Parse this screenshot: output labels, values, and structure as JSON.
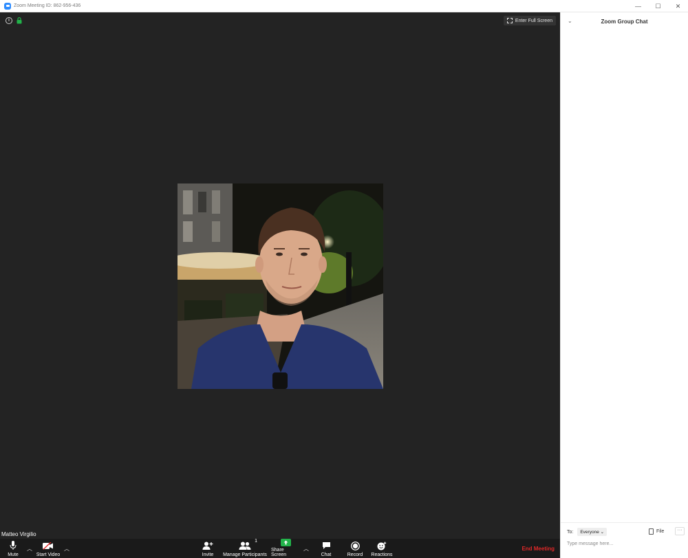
{
  "window": {
    "title": "Zoom Meeting ID: 862-956-436",
    "controls": {
      "minimize": "—",
      "maximize": "☐",
      "close": "✕"
    }
  },
  "meeting": {
    "fullscreen_label": "Enter Full Screen",
    "participant_name": "Matteo Virgilio"
  },
  "toolbar": {
    "mute": "Mute",
    "start_video": "Start Video",
    "invite": "Invite",
    "manage_participants": "Manage Participants",
    "participant_count": "1",
    "share_screen": "Share Screen",
    "chat": "Chat",
    "record": "Record",
    "reactions": "Reactions",
    "end_meeting": "End Meeting"
  },
  "chat": {
    "title": "Zoom Group Chat",
    "to_label": "To:",
    "recipient": "Everyone",
    "file_label": "File",
    "more_label": "···",
    "input_placeholder": "Type message here..."
  },
  "colors": {
    "meeting_bg": "#232323",
    "toolbar_bg": "#1a1a1a",
    "end_meeting": "#e02828",
    "share_green": "#22b34a",
    "brand_blue": "#2d8cff"
  }
}
